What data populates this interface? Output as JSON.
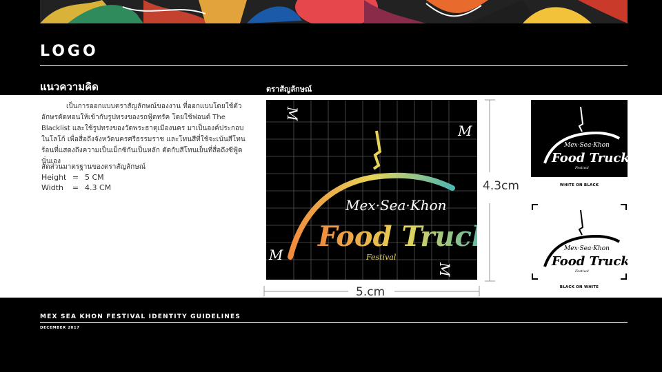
{
  "section_title": "LOGO",
  "concept": {
    "heading": "แนวความคิด",
    "body": "เป็นการออกแบบตราสัญลักษณ์ของงาน ที่ออกแบบโดยใช้ตัวอักษรตัดทอนให้เข้ากับรูปทรงของรถฟู้ดทรัค โดยใช้ฟอนต์ The Blacklist และใช้รูปทรงของวัดพระธาตุเมืองนคร มาเป็นองค์ประกอบในโลโก้ เพื่อสื่อถึงจังหวัดนครศรีธรรมราช และโทนสีที่ใช้จะเน้นสีโทนร้อนที่แสดงถึงความเป็นเม็กซิกันเป็นหลัก ตัดกับสีโทนเย็นที่สื่อถึงซีฟู้ดนั่นเอง",
    "ratio_title": "สัดส่วนมาตรฐานของตราสัญลักษณ์",
    "dimensions": [
      {
        "label": "Height",
        "eq": "=",
        "value": "5 CM"
      },
      {
        "label": "Width",
        "eq": "=",
        "value": "4.3 CM"
      }
    ]
  },
  "symbol": {
    "heading": "ตราสัญลักษณ์",
    "logo_line1": "Mex·Sea·Khon",
    "logo_line2": "Food Truck",
    "logo_line3": "Festival",
    "corner_mark": "M",
    "height_label": "4.3cm",
    "width_label": "5.cm"
  },
  "variants": [
    {
      "caption": "WHITE ON BLACK",
      "bg": "#000000",
      "fg": "#ffffff"
    },
    {
      "caption": "BLACK ON WHITE",
      "bg": "#ffffff",
      "fg": "#000000"
    }
  ],
  "footer": {
    "title": "MEX SEA KHON FESTIVAL IDENTITY GUIDELINES",
    "date": "DECEMBER 2017"
  },
  "colors": {
    "background": "#000000",
    "band": "#ffffff",
    "gradient_warm": "#f08a3c",
    "gradient_yellow": "#e7d45a",
    "gradient_cool": "#4fb7b0"
  }
}
